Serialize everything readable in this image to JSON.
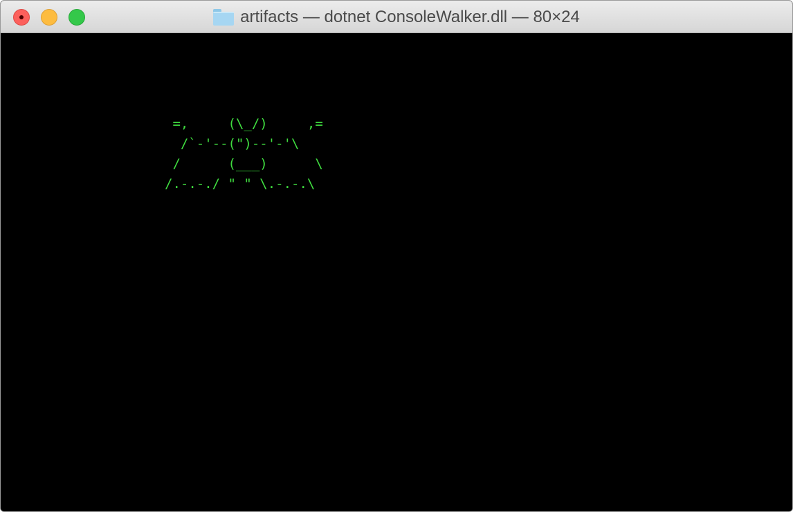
{
  "window": {
    "title": "artifacts — dotnet ConsoleWalker.dll — 80×24",
    "title_icon": "folder-icon",
    "buttons": [
      "close",
      "minimize",
      "zoom"
    ]
  },
  "terminal": {
    "background": "#000000",
    "text_color": "#3fdc3f",
    "art_lines": [
      " =,     (\\_/)     ,=",
      "  /`-'--(\")--'-'\\",
      " /      (___)      \\",
      "/.-.-./ \" \" \\.-.-.\\"
    ]
  },
  "colors": {
    "close": "#fc605c",
    "minimize": "#fdbc40",
    "zoom": "#34c84a"
  }
}
